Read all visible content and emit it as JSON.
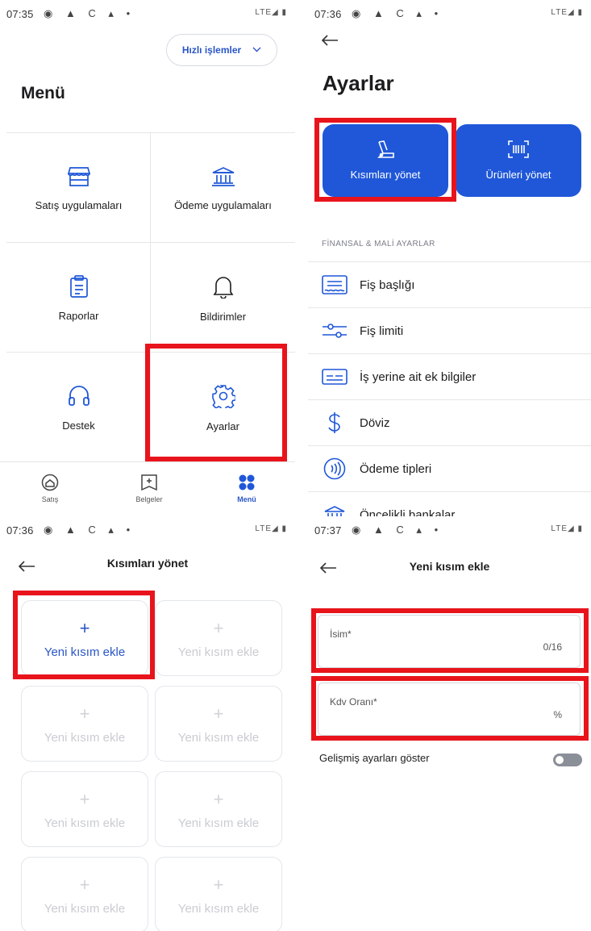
{
  "panel1": {
    "status": {
      "time": "07:35",
      "icons": "◉ ▲ C ▴ •",
      "network": "LTE◢ ▮"
    },
    "quick_actions_label": "Hızlı işlemler",
    "title": "Menü",
    "tiles": [
      {
        "label": "Satış uygulamaları",
        "icon": "store-icon"
      },
      {
        "label": "Ödeme uygulamaları",
        "icon": "bank-icon"
      },
      {
        "label": "Raporlar",
        "icon": "clipboard-icon"
      },
      {
        "label": "Bildirimler",
        "icon": "bell-icon"
      },
      {
        "label": "Destek",
        "icon": "headset-icon"
      },
      {
        "label": "Ayarlar",
        "icon": "gear-icon"
      }
    ],
    "bottom_nav": [
      {
        "label": "Satış",
        "icon": "home-icon"
      },
      {
        "label": "Belgeler",
        "icon": "document-add-icon"
      },
      {
        "label": "Menü",
        "icon": "grid-dots-icon",
        "active": true
      }
    ]
  },
  "panel2": {
    "status": {
      "time": "07:36",
      "icons": "◉ ▲ C ▴ •",
      "network": "LTE◢ ▮"
    },
    "title": "Ayarlar",
    "buttons": [
      {
        "label": "Kısımları yönet",
        "icon": "swatch-icon"
      },
      {
        "label": "Ürünleri yönet",
        "icon": "barcode-scan-icon"
      }
    ],
    "section_title": "FİNANSAL & MALİ AYARLAR",
    "rows": [
      {
        "label": "Fiş başlığı",
        "icon": "receipt-header-icon"
      },
      {
        "label": "Fiş limiti",
        "icon": "sliders-icon"
      },
      {
        "label": "İş yerine ait ek bilgiler",
        "icon": "info-card-icon"
      },
      {
        "label": "Döviz",
        "icon": "dollar-icon"
      },
      {
        "label": "Ödeme tipleri",
        "icon": "contactless-icon"
      },
      {
        "label": "Öncelikli bankalar",
        "icon": "bank-icon"
      }
    ]
  },
  "panel3": {
    "status": {
      "time": "07:36",
      "icons": "◉ ▲ C ▴ •",
      "network": "LTE◢ ▮"
    },
    "title": "Kısımları yönet",
    "cards": [
      {
        "label": "Yeni kısım ekle",
        "active": true
      },
      {
        "label": "Yeni kısım ekle"
      },
      {
        "label": "Yeni kısım ekle"
      },
      {
        "label": "Yeni kısım ekle"
      },
      {
        "label": "Yeni kısım ekle"
      },
      {
        "label": "Yeni kısım ekle"
      },
      {
        "label": "Yeni kısım ekle"
      },
      {
        "label": "Yeni kısım ekle"
      }
    ],
    "plus_symbol": "+"
  },
  "panel4": {
    "status": {
      "time": "07:37",
      "icons": "◉ ▲ C ▴ •",
      "network": "LTE◢ ▮"
    },
    "title": "Yeni kısım ekle",
    "name_field": {
      "label": "İsim*",
      "counter": "0/16"
    },
    "vat_field": {
      "label": "Kdv Oranı*",
      "suffix": "%"
    },
    "advanced_label": "Gelişmiş ayarları göster",
    "advanced_enabled": false
  },
  "colors": {
    "accent": "#1f57d8",
    "highlight": "#e8141c",
    "divider": "#e6e6e6"
  }
}
